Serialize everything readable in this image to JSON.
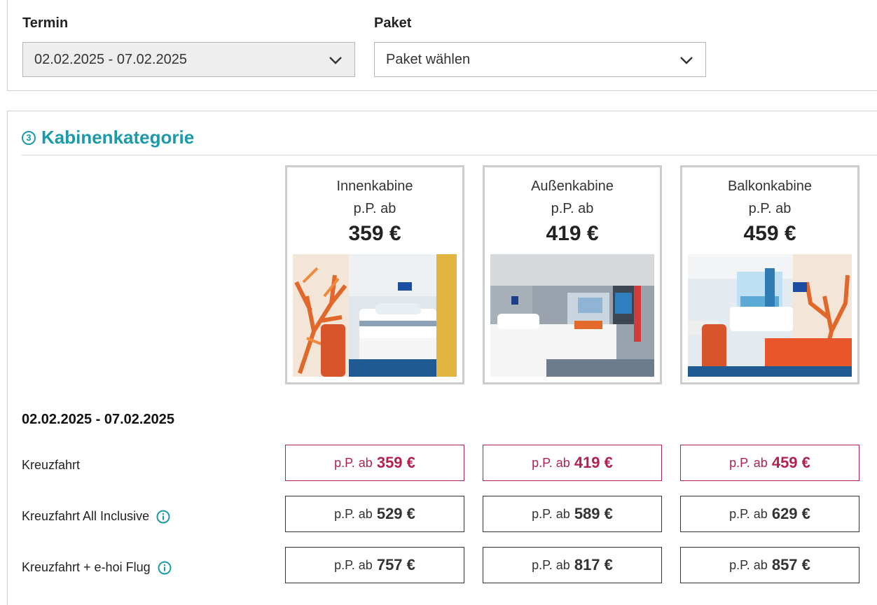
{
  "filters": {
    "termin": {
      "label": "Termin",
      "value": "02.02.2025 - 07.02.2025"
    },
    "paket": {
      "label": "Paket",
      "value": "Paket wählen"
    }
  },
  "section": {
    "number": "3",
    "title": "Kabinenkategorie"
  },
  "cabins": [
    {
      "name": "Innenkabine",
      "from_label": "p.P. ab",
      "price": "359 €",
      "image": "interior-cabin-photo"
    },
    {
      "name": "Außenkabine",
      "from_label": "p.P. ab",
      "price": "419 €",
      "image": "ocean-view-cabin-photo"
    },
    {
      "name": "Balkonkabine",
      "from_label": "p.P. ab",
      "price": "459 €",
      "image": "balcony-cabin-photo"
    }
  ],
  "date_heading": "02.02.2025 - 07.02.2025",
  "rows": [
    {
      "label": "Kreuzfahrt",
      "info": false,
      "prefix": "p.P. ab",
      "prices": [
        "359 €",
        "419 €",
        "459 €"
      ]
    },
    {
      "label": "Kreuzfahrt All Inclusive",
      "info": true,
      "prefix": "p.P. ab",
      "prices": [
        "529 €",
        "589 €",
        "629 €"
      ]
    },
    {
      "label": "Kreuzfahrt + e-hoi Flug",
      "info": true,
      "prefix": "p.P. ab",
      "prices": [
        "757 €",
        "817 €",
        "857 €"
      ]
    }
  ],
  "colors": {
    "accent": "#1a9aaa",
    "highlight": "#b3214e"
  },
  "icons": {
    "dropdown": "chevron-down-icon",
    "info": "info-icon"
  }
}
